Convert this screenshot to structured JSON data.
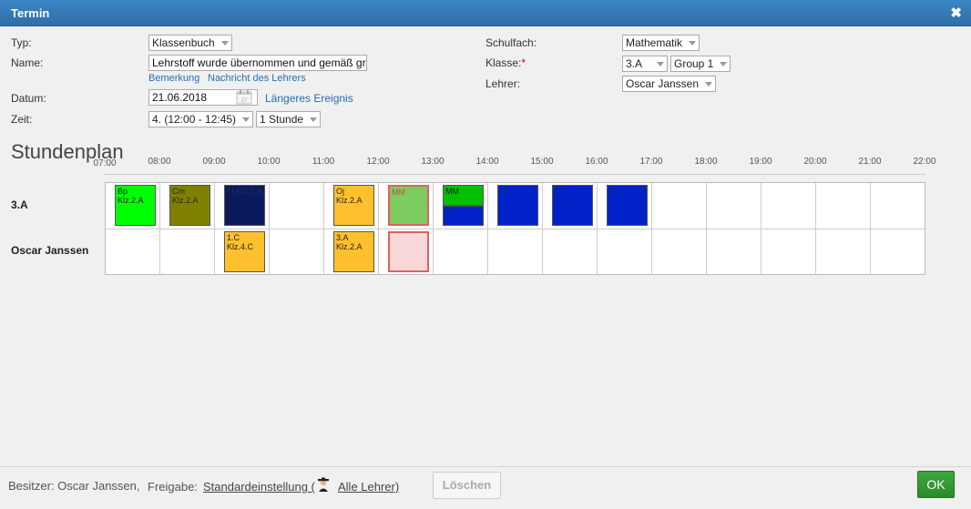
{
  "dialog": {
    "title": "Termin"
  },
  "form": {
    "typ_label": "Typ:",
    "typ_value": "Klassenbuch",
    "name_label": "Name:",
    "name_value": "Lehrstoff wurde übernommen und gemäß gr",
    "link_bemerkung": "Bemerkung",
    "link_nachricht": "Nachricht des Lehrers",
    "datum_label": "Datum:",
    "datum_value": "21.06.2018",
    "link_laengeres": "Längeres Ereignis",
    "zeit_label": "Zeit:",
    "zeit_value": "4. (12:00 - 12:45)",
    "dauer_value": "1 Stunde",
    "schulfach_label": "Schulfach:",
    "schulfach_value": "Mathematik",
    "klasse_label": "Klasse:",
    "klasse_required": "*",
    "klasse_value": "3.A",
    "group_value": "Group 1",
    "lehrer_label": "Lehrer:",
    "lehrer_value": "Oscar Janssen"
  },
  "schedule": {
    "title": "Stundenplan",
    "hours": [
      "07:00",
      "08:00",
      "09:00",
      "10:00",
      "11:00",
      "12:00",
      "13:00",
      "14:00",
      "15:00",
      "16:00",
      "17:00",
      "18:00",
      "19:00",
      "20:00",
      "21:00",
      "22:00"
    ],
    "rows": [
      "3.A",
      "Oscar Janssen"
    ],
    "events": [
      {
        "row": 0,
        "hour": 0,
        "lines": [
          "Bp",
          "Klz.2.A"
        ],
        "color": "#00ff00",
        "half": "full"
      },
      {
        "row": 0,
        "hour": 1,
        "lines": [
          "Cm",
          "Klz.2.A"
        ],
        "color": "#808000",
        "half": "full"
      },
      {
        "row": 0,
        "hour": 2,
        "lines": [
          "Tl Klz.2.A"
        ],
        "color": "#0b1a5a",
        "half": "full"
      },
      {
        "row": 0,
        "hour": 4,
        "lines": [
          "Oj Klz.2.A"
        ],
        "color": "#ffc02e",
        "half": "full"
      },
      {
        "row": 0,
        "hour": 5,
        "lines": [
          "MM"
        ],
        "color": "#7dcc60",
        "half": "full",
        "current": true
      },
      {
        "row": 0,
        "hour": 6,
        "lines": [
          "MM"
        ],
        "color": "#00c000",
        "half": "top"
      },
      {
        "row": 0,
        "hour": 6,
        "lines": [
          "Af"
        ],
        "color": "#0022c8",
        "half": "bottom"
      },
      {
        "row": 0,
        "hour": 7,
        "lines": [
          "Af"
        ],
        "color": "#0022c8",
        "half": "full"
      },
      {
        "row": 0,
        "hour": 8,
        "lines": [
          "Af"
        ],
        "color": "#0022c8",
        "half": "full"
      },
      {
        "row": 0,
        "hour": 9,
        "lines": [
          "Af"
        ],
        "color": "#0022c8",
        "half": "full"
      },
      {
        "row": 1,
        "hour": 2,
        "lines": [
          "1.C",
          "Klz.4.C"
        ],
        "color": "#ffc02e",
        "half": "full"
      },
      {
        "row": 1,
        "hour": 4,
        "lines": [
          "3.A",
          "Klz.2.A"
        ],
        "color": "#ffc02e",
        "half": "full"
      },
      {
        "row": 1,
        "hour": 5,
        "lines": [],
        "color": "#f8d7d9",
        "half": "full",
        "current": true
      }
    ]
  },
  "footer": {
    "besitzer": "Besitzer: Oscar Janssen,",
    "freigabe_label": "Freigabe:",
    "freigabe_link": "Standardeinstellung (",
    "freigabe_icon": "teacher-icon",
    "alle_lehrer": "Alle Lehrer)",
    "delete_label": "Löschen",
    "ok_label": "OK"
  }
}
